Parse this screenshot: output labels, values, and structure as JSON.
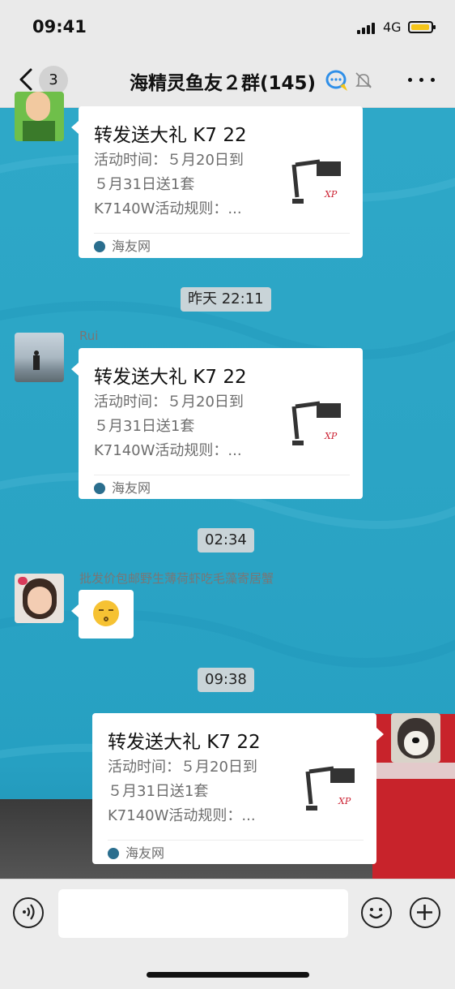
{
  "status_bar": {
    "time": "09:41",
    "network": "4G",
    "battery_level": 0.8
  },
  "header": {
    "back_count": "3",
    "title": "海精灵鱼友２群(145)"
  },
  "messages": [
    {
      "type": "link_card",
      "sender": "",
      "title": "转发送大礼 K7 22",
      "desc_lines": [
        "活动时间：５月20日到",
        "５月31日送1套",
        "K7140W活动规则：..."
      ],
      "source": "海友网"
    },
    {
      "type": "timestamp",
      "text": "昨天 22:11"
    },
    {
      "type": "link_card",
      "sender": "Rui",
      "title": "转发送大礼 K7 22",
      "desc_lines": [
        "活动时间：５月20日到",
        "５月31日送1套",
        "K7140W活动规则：..."
      ],
      "source": "海友网"
    },
    {
      "type": "timestamp",
      "text": "02:34"
    },
    {
      "type": "emoji",
      "sender": "批发价包邮野生薄荷虾吃毛藻寄居蟹"
    },
    {
      "type": "timestamp",
      "text": "09:38"
    },
    {
      "type": "link_card",
      "sender": "",
      "outgoing": true,
      "title": "转发送大礼 K7 22",
      "desc_lines": [
        "活动时间：５月20日到",
        "５月31日送1套",
        "K7140W活动规则：..."
      ],
      "source": "海友网"
    }
  ],
  "colors": {
    "chat_bg": "#2aa5c6",
    "bar_bg": "#eaeaea",
    "accent_yellow": "#f5c518"
  }
}
